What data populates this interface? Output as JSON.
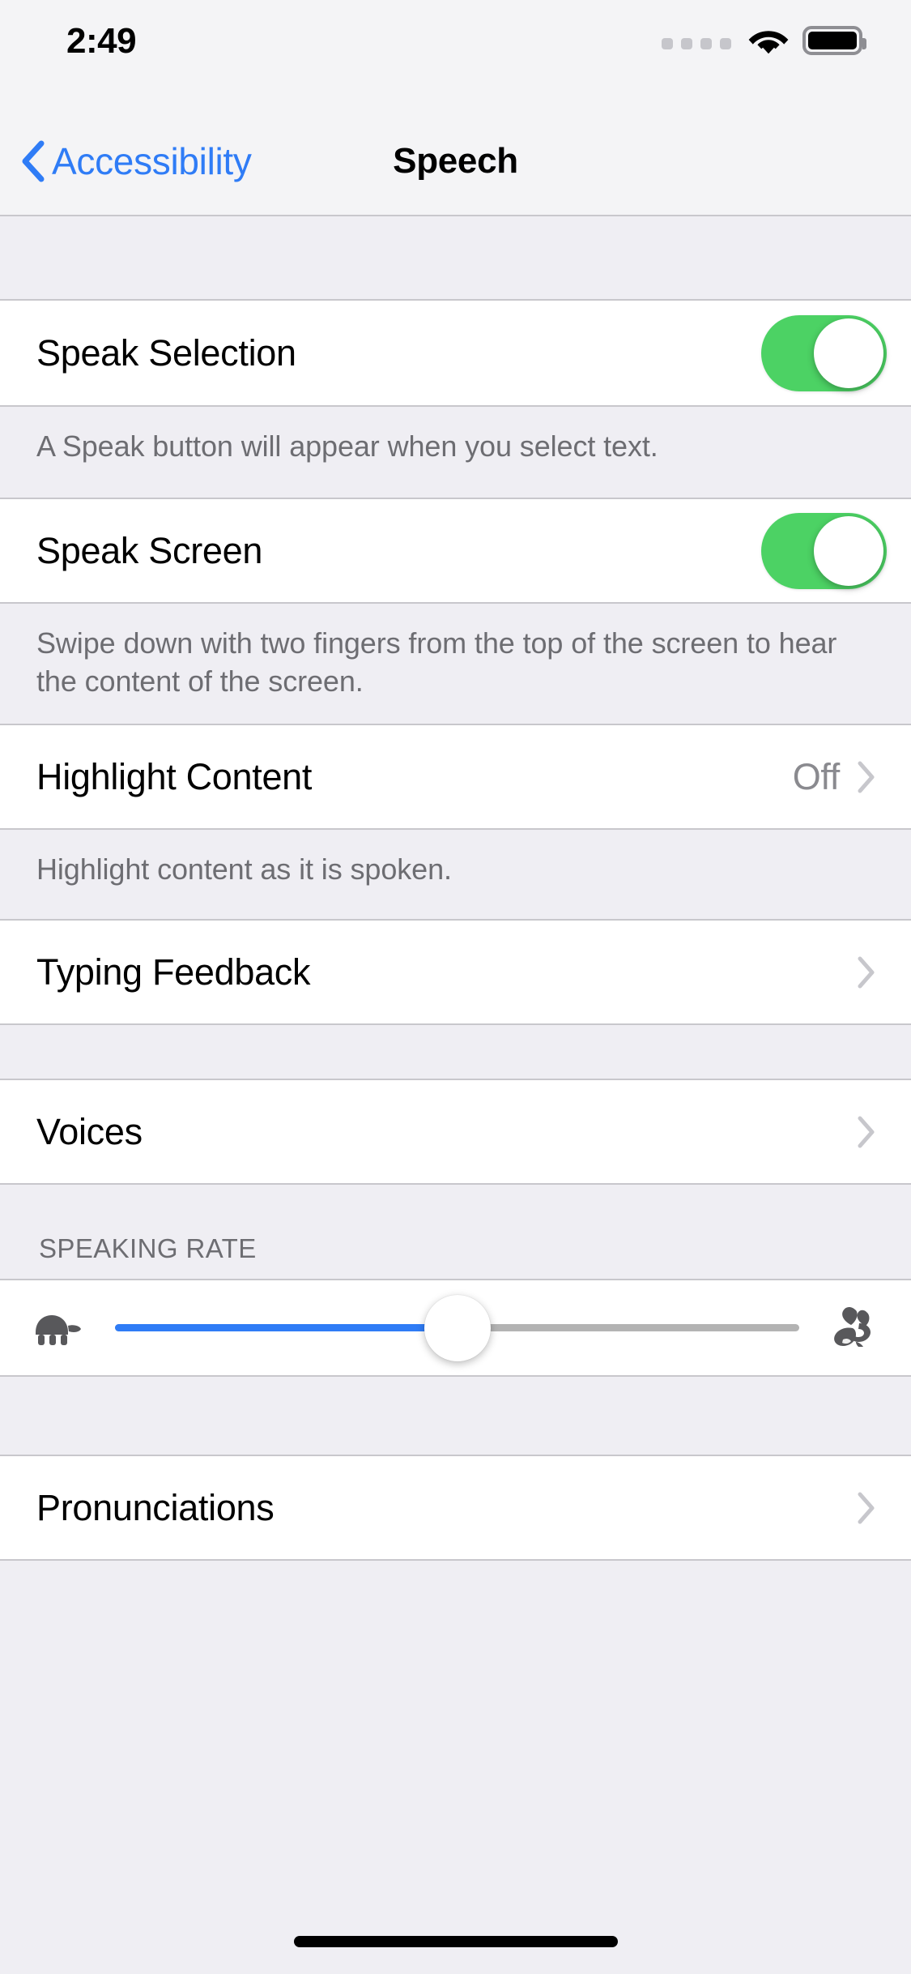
{
  "status_bar": {
    "time": "2:49",
    "signal_dots": 4,
    "wifi_icon": "wifi-icon",
    "battery_icon": "battery-full-icon",
    "battery_level": "100"
  },
  "nav": {
    "back_label": "Accessibility",
    "back_icon": "chevron-left-icon",
    "title": "Speech"
  },
  "colors": {
    "accent_blue": "#2F7CF6",
    "toggle_on_green": "#4CD264",
    "group_background": "#EFEEF3",
    "cell_background": "#FFFFFF",
    "separator": "#C8C7CC",
    "secondary_text": "#6D6D72",
    "value_text": "#8A8A8F"
  },
  "sections": [
    {
      "rows": [
        {
          "title": "Speak Selection",
          "control": "toggle",
          "toggle_state": "on"
        }
      ],
      "footer": "A Speak button will appear when you select text."
    },
    {
      "rows": [
        {
          "title": "Speak Screen",
          "control": "toggle",
          "toggle_state": "on"
        }
      ],
      "footer": "Swipe down with two fingers from the top of the screen to hear the content of the screen."
    },
    {
      "rows": [
        {
          "title": "Highlight Content",
          "control": "disclosure",
          "value": "Off"
        }
      ],
      "footer": "Highlight content as it is spoken."
    },
    {
      "rows": [
        {
          "title": "Typing Feedback",
          "control": "disclosure",
          "value": ""
        }
      ],
      "footer": ""
    },
    {
      "rows": [
        {
          "title": "Voices",
          "control": "disclosure",
          "value": ""
        }
      ],
      "footer": ""
    }
  ],
  "speaking_rate": {
    "header": "SPEAKING RATE",
    "slow_icon": "turtle-icon",
    "fast_icon": "rabbit-icon",
    "value_percent": 50
  },
  "pronunciations": {
    "title": "Pronunciations",
    "control": "disclosure"
  },
  "home_indicator": "home-indicator"
}
